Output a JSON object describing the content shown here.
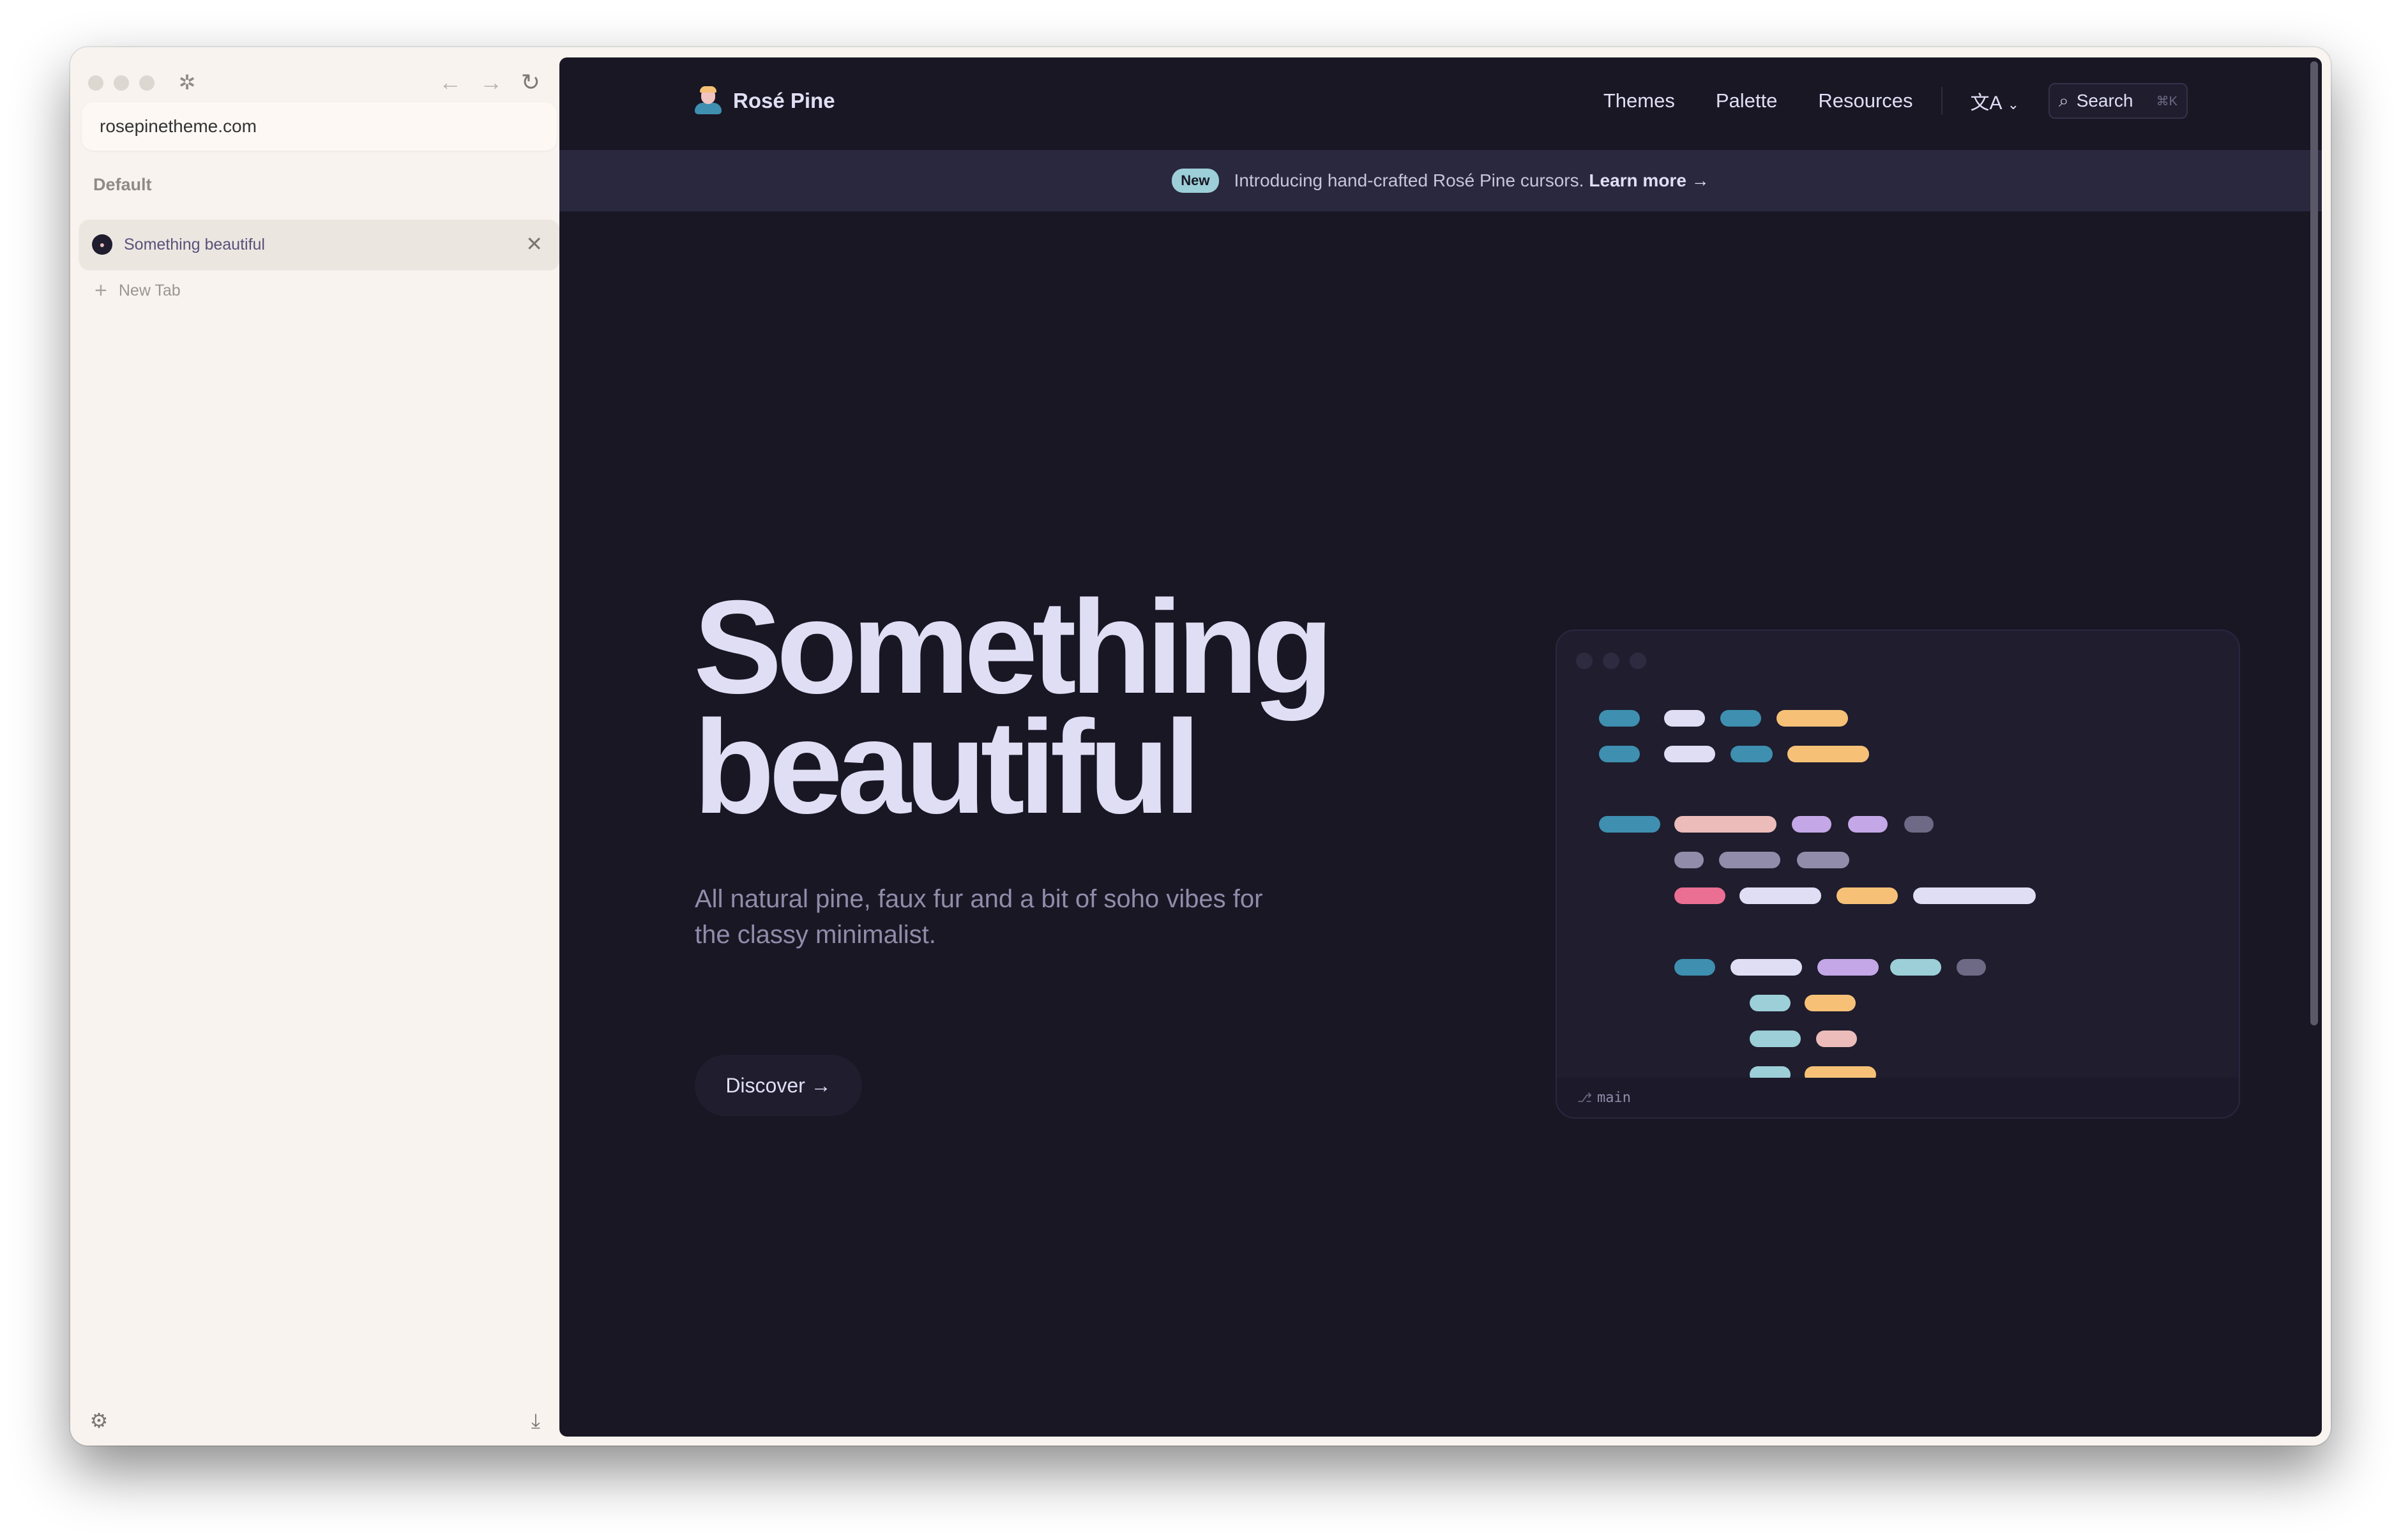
{
  "browser": {
    "url": "rosepinetheme.com",
    "section_label": "Default",
    "active_tab_title": "Something beautiful",
    "new_tab_label": "New Tab"
  },
  "header": {
    "brand": "Rosé Pine",
    "nav": [
      "Themes",
      "Palette",
      "Resources"
    ],
    "language_icon": "translate-icon",
    "search_label": "Search",
    "search_shortcut": "⌘K"
  },
  "announcement": {
    "badge": "New",
    "text": "Introducing hand-crafted Rosé Pine cursors.",
    "link": "Learn more →"
  },
  "hero": {
    "title_line1": "Something",
    "title_line2": "beautiful",
    "subtitle": "All natural pine, faux fur and a bit of soho vibes for the classy minimalist.",
    "cta": "Discover →"
  },
  "code_preview": {
    "branch": "main"
  },
  "colors": {
    "base": "#191724",
    "surface": "#1f1d2e",
    "overlay": "#2a283e",
    "text": "#e0def4",
    "subtle": "#908caa",
    "pine": "#3e8fb0",
    "foam": "#9ccfd8",
    "gold": "#f6c177",
    "rose": "#ebbcba",
    "iris": "#c4a7e7",
    "love": "#eb6f92",
    "muted": "#6e6a86",
    "browser_bg": "#f8f3ee"
  }
}
